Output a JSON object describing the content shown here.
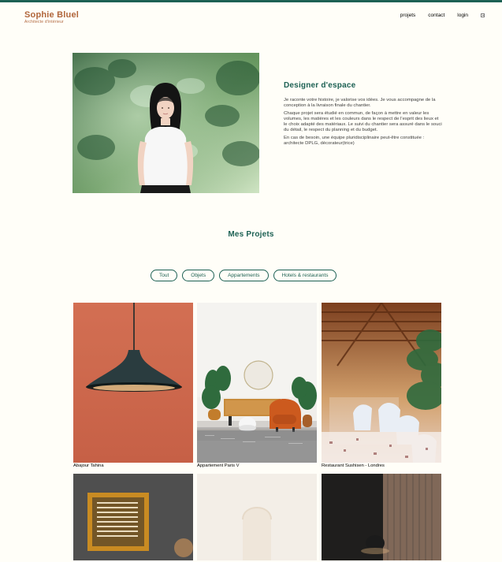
{
  "brand": {
    "name": "Sophie Bluel",
    "subtitle": "Architecte d'intérieur"
  },
  "nav": {
    "items": [
      "projets",
      "contact",
      "login"
    ],
    "menu_icon": "instagram-icon"
  },
  "introduction": {
    "title": "Designer d'espace",
    "paragraphs": [
      "Je raconte votre histoire, je valorise vos idées. Je vous accompagne de la conception à la livraison finale du chantier.",
      "Chaque projet sera étudié en commun, de façon à mettre en valeur les volumes, les matières et les couleurs dans le respect de l’esprit des lieux et le choix adapté des matériaux. Le suivi du chantier sera assuré dans le souci du détail, le respect du planning et du budget.",
      "En cas de besoin, une équipe pluridisciplinaire peut-être constituée : architecte DPLG, décorateur(trice)"
    ]
  },
  "projects": {
    "title": "Mes Projets",
    "filters": [
      "Tout",
      "Objets",
      "Appartements",
      "Hotels & restaurants"
    ],
    "items": [
      {
        "caption": "Abajour Tahina"
      },
      {
        "caption": "Appartement Paris V"
      },
      {
        "caption": "Restaurant Sushisen - Londres"
      },
      {
        "caption": ""
      },
      {
        "caption": ""
      },
      {
        "caption": ""
      }
    ]
  },
  "colors": {
    "brand": "#B1663C",
    "accent": "#1D6154",
    "background": "#FFFEF8",
    "text": "#3D3D3D"
  }
}
